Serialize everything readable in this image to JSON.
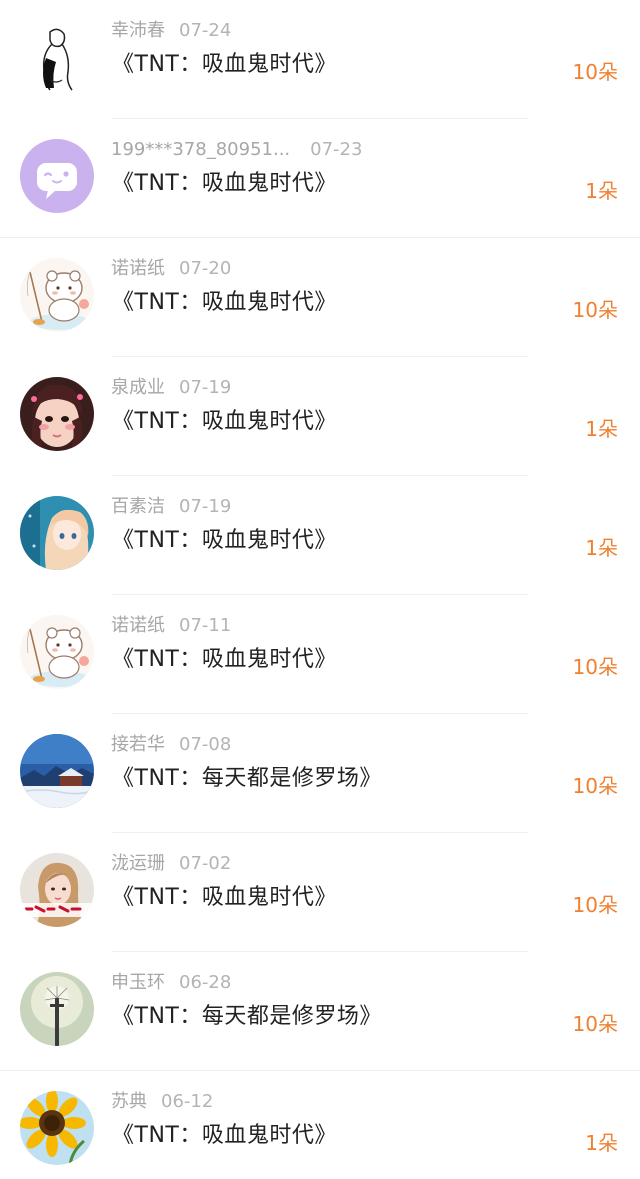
{
  "colors": {
    "amount": "#f08030",
    "name": "#a7a7a7",
    "title": "#222222"
  },
  "items": [
    {
      "name": "幸沛春",
      "date": "07-24",
      "title": "《TNT：吸血鬼时代》",
      "amount": "10朵",
      "avatar": "sketch-figure-avatar"
    },
    {
      "name": "199***378_80951...",
      "date": "07-23",
      "title": "《TNT：吸血鬼时代》",
      "amount": "1朵",
      "avatar": "chat-bubble-avatar"
    },
    {
      "name": "诺诺纸",
      "date": "07-20",
      "title": "《TNT：吸血鬼时代》",
      "amount": "10朵",
      "avatar": "cartoon-bear-avatar"
    },
    {
      "name": "泉成业",
      "date": "07-19",
      "title": "《TNT：吸血鬼时代》",
      "amount": "1朵",
      "avatar": "girl-photo-avatar"
    },
    {
      "name": "百素洁",
      "date": "07-19",
      "title": "《TNT：吸血鬼时代》",
      "amount": "1朵",
      "avatar": "anime-girl-avatar"
    },
    {
      "name": "诺诺纸",
      "date": "07-11",
      "title": "《TNT：吸血鬼时代》",
      "amount": "10朵",
      "avatar": "cartoon-bear-avatar"
    },
    {
      "name": "接若华",
      "date": "07-08",
      "title": "《TNT：每天都是修罗场》",
      "amount": "10朵",
      "avatar": "snow-landscape-avatar"
    },
    {
      "name": "泷运珊",
      "date": "07-02",
      "title": "《TNT：吸血鬼时代》",
      "amount": "10朵",
      "avatar": "woman-photo-avatar"
    },
    {
      "name": "申玉环",
      "date": "06-28",
      "title": "《TNT：每天都是修罗场》",
      "amount": "10朵",
      "avatar": "dandelion-avatar"
    },
    {
      "name": "苏典",
      "date": "06-12",
      "title": "《TNT：吸血鬼时代》",
      "amount": "1朵",
      "avatar": "sunflower-avatar"
    }
  ]
}
